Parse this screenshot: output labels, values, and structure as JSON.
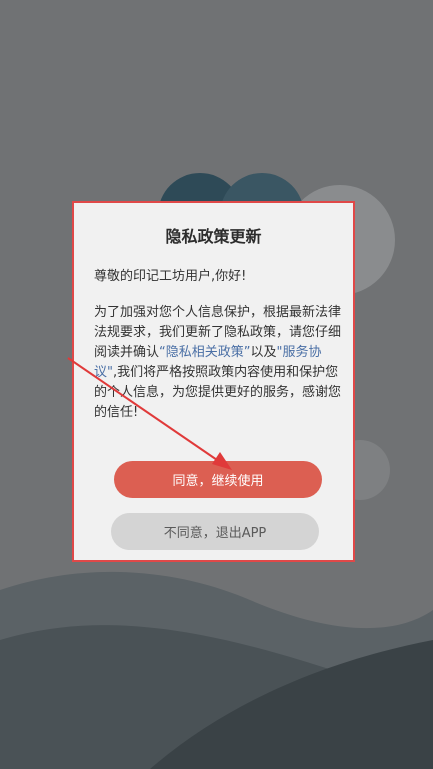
{
  "dialog": {
    "title": "隐私政策更新",
    "greeting": "尊敬的印记工坊用户,你好!",
    "body_part1": "为了加强对您个人信息保护，根据最新法律法规要求，我们更新了隐私政策，请您仔细阅读并确认",
    "link_privacy": "“隐私相关政策”",
    "body_part2": "以及",
    "link_service": "\"服务协议\"",
    "body_part3": ",我们将严格按照政策内容使用和保护您的个人信息，为您提供更好的服务，感谢您的信任!",
    "agree_label": "同意，继续使用",
    "disagree_label": "不同意，退出APP"
  },
  "colors": {
    "accent": "#dc5f52",
    "highlight_border": "#e04848",
    "link": "#4a6fa5"
  }
}
